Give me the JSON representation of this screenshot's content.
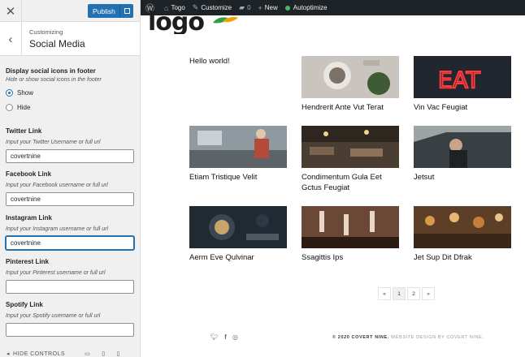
{
  "panel": {
    "close_icon": "close-icon",
    "publish_label": "Publish",
    "breadcrumb": "Customizing",
    "section_title": "Social Media",
    "display": {
      "title": "Display social icons in footer",
      "description": "Hide or show social icons in the footer",
      "options": [
        "Show",
        "Hide"
      ],
      "selected": "Show"
    },
    "twitter": {
      "title": "Twitter Link",
      "description": "Input your Twitter Username or full url",
      "value": "covertnine"
    },
    "facebook": {
      "title": "Facebook Link",
      "description": "Input your Facebook username or full url",
      "value": "covertnine"
    },
    "instagram": {
      "title": "Instagram Link",
      "description": "Input your Instagram username or full url",
      "value": "covertnine"
    },
    "pinterest": {
      "title": "Pinterest Link",
      "description": "Input your Pinterest username or full url",
      "value": ""
    },
    "spotify": {
      "title": "Spotify Link",
      "description": "Input your Spotify username or full url",
      "value": ""
    },
    "hide_controls": "HIDE CONTROLS"
  },
  "adminbar": {
    "site": "Togo",
    "customize": "Customize",
    "comments": "0",
    "new": "New",
    "autoptimize": "Autoptimize"
  },
  "site": {
    "logo": "logo",
    "posts": [
      "Hello world!",
      "Hendrerit Ante Vut Terat",
      "Vin Vac Feugiat",
      "Etiam Tristique Velit",
      "Condimentum Gula Eet Gctus Feugiat",
      "Jetsut",
      "Aerm Eve Qulvinar",
      "Ssagittis Ips",
      "Jet Sup Dit Dfrak"
    ],
    "pager": {
      "prev": "«",
      "pages": [
        "1",
        "2"
      ],
      "next": "»",
      "current": "1"
    },
    "copyright": "© 2020 COVERT NINE.",
    "credit": " WEBSITE DESIGN BY COVERT NINE."
  },
  "colors": {
    "accent": "#2271b1",
    "adminbar": "#1d2327",
    "status": "#4ab866"
  }
}
